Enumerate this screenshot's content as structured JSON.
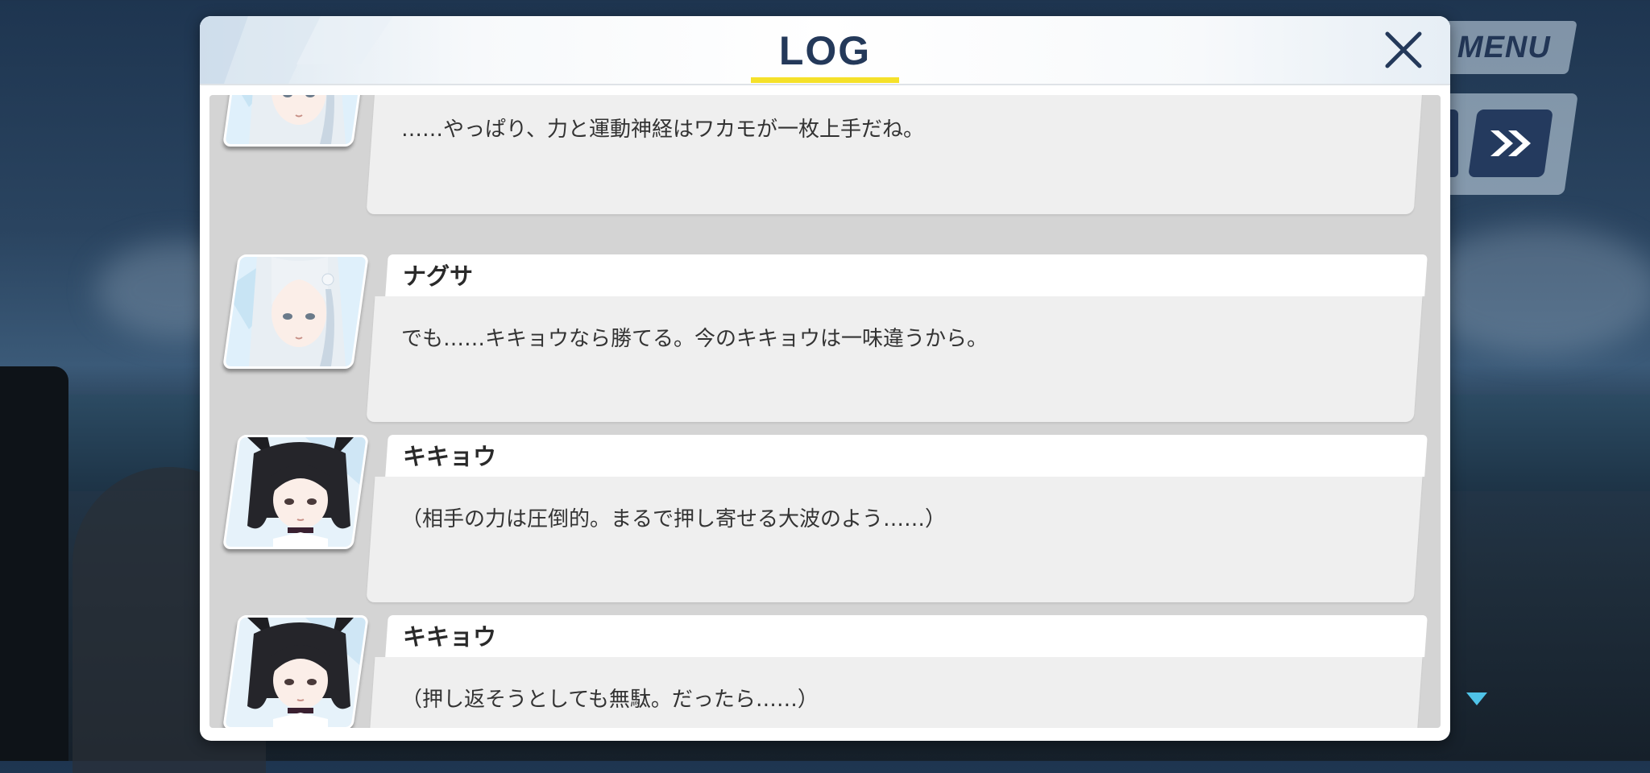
{
  "top_right": {
    "menu_label": "MENU",
    "fast_forward_icon": "double-chevron-right-icon"
  },
  "log": {
    "title": "LOG",
    "close_icon": "close-x-icon",
    "accent_color": "#f5e12a",
    "entries": [
      {
        "speaker": "",
        "text": "……やっぱり、力と運動神経はワカモが一枚上手だね。",
        "portrait": "white-haired-girl-portrait"
      },
      {
        "speaker": "ナグサ",
        "text": "でも……キキョウなら勝てる。今のキキョウは一味違うから。",
        "portrait": "white-haired-girl-portrait"
      },
      {
        "speaker": "キキョウ",
        "text": "（相手の力は圧倒的。まるで押し寄せる大波のよう……）",
        "portrait": "black-haired-cat-ear-girl-portrait"
      },
      {
        "speaker": "キキョウ",
        "text": "（押し返そうとしても無駄。だったら……）",
        "portrait": "black-haired-cat-ear-girl-portrait"
      }
    ]
  },
  "scroll_indicator_icon": "triangle-down-icon"
}
